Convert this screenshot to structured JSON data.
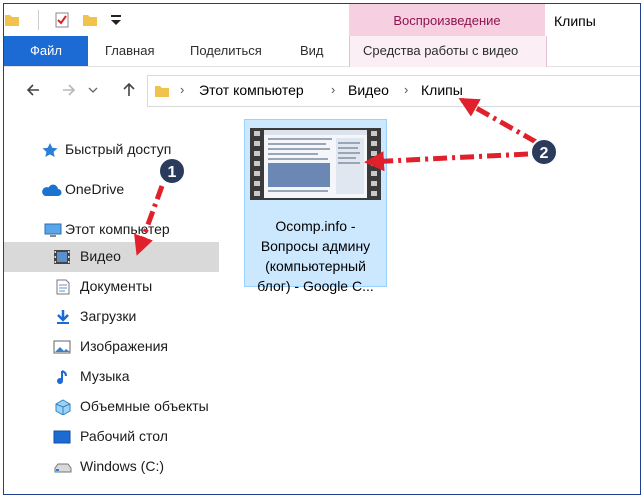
{
  "window": {
    "title": "Клипы"
  },
  "ribbon": {
    "context_group": "Воспроизведение",
    "tabs": [
      "Файл",
      "Главная",
      "Поделиться",
      "Вид",
      "Средства работы с видео"
    ]
  },
  "address": {
    "crumbs": [
      "Этот компьютер",
      "Видео",
      "Клипы"
    ]
  },
  "sidebar": {
    "items": [
      {
        "label": "Быстрый доступ",
        "icon": "star-icon"
      },
      {
        "label": "OneDrive",
        "icon": "cloud-icon"
      },
      {
        "label": "Этот компьютер",
        "icon": "computer-icon"
      },
      {
        "label": "Видео",
        "icon": "film-icon",
        "selected": true
      },
      {
        "label": "Документы",
        "icon": "document-icon"
      },
      {
        "label": "Загрузки",
        "icon": "download-icon"
      },
      {
        "label": "Изображения",
        "icon": "image-icon"
      },
      {
        "label": "Музыка",
        "icon": "music-icon"
      },
      {
        "label": "Объемные объекты",
        "icon": "cube-icon"
      },
      {
        "label": "Рабочий стол",
        "icon": "desktop-icon"
      },
      {
        "label": "Windows (C:)",
        "icon": "drive-icon"
      }
    ]
  },
  "content": {
    "file": {
      "lines": [
        "Ocomp.info -",
        "Вопросы админу",
        "(компьютерный",
        "блог) - Google C..."
      ]
    }
  },
  "annotations": {
    "badge1": "1",
    "badge2": "2"
  },
  "colors": {
    "accent": "#1c6bd5",
    "selection": "#cce8ff",
    "arrow": "#e0202a",
    "context": "#f6cfe0"
  }
}
